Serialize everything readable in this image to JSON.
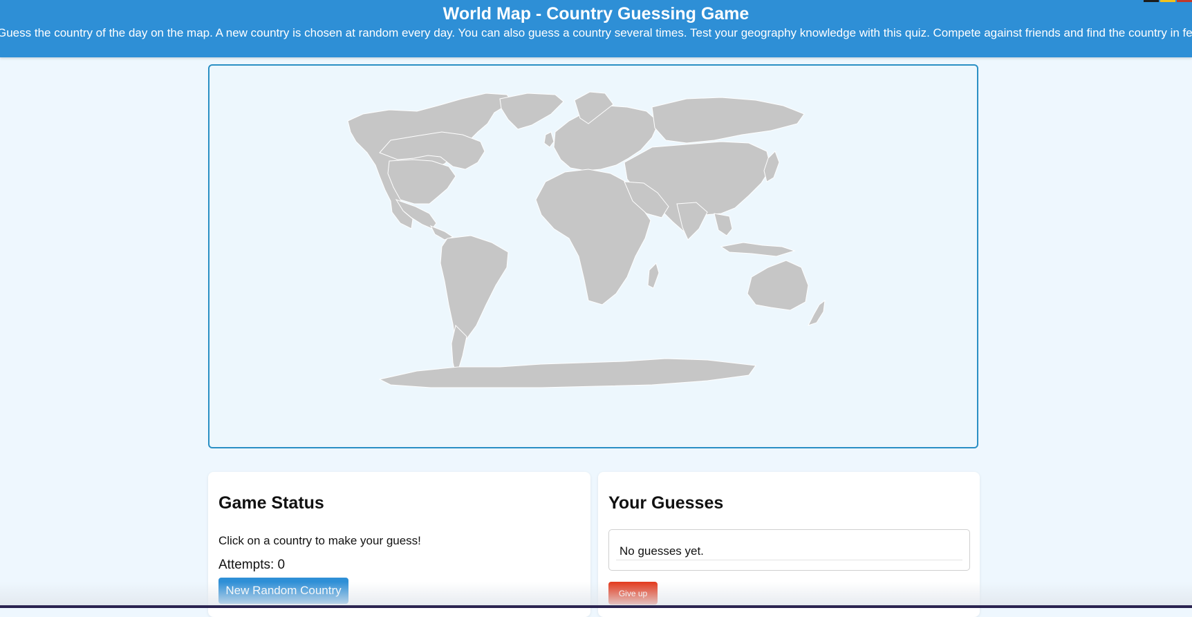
{
  "header": {
    "title": "World Map - Country Guessing Game",
    "subtitle": "Guess the country of the day on the map. A new country is chosen at random every day. You can also guess a country several times. Test your geography knowledge with this quiz. Compete against friends and find the country in fewer attempts."
  },
  "language_flags": [
    "#1c1c1c",
    "#f2c21b",
    "#c0392b"
  ],
  "map": {
    "land_color": "#c6c6c6",
    "ocean_color": "#edf7fd",
    "border_color": "#2a8fc4"
  },
  "game_status": {
    "heading": "Game Status",
    "instruction": "Click on a country to make your guess!",
    "attempts_text": "Attempts: 0",
    "new_country_button": "New Random Country"
  },
  "guesses": {
    "heading": "Your Guesses",
    "empty_text": "No guesses yet.",
    "give_up_button": "Give up"
  },
  "colors": {
    "accent": "#2e8fd6",
    "danger": "#e3391c",
    "background": "#eef7fe"
  }
}
